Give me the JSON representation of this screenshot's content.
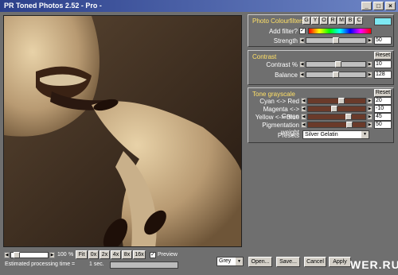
{
  "window": {
    "title": "PR Toned Photos 2.52 - Pro -",
    "min": "_",
    "max": "□",
    "close": "×"
  },
  "colourfilters": {
    "title": "Photo Colourfilters",
    "buttons": [
      "G",
      "Y",
      "O",
      "R",
      "M",
      "B",
      "C"
    ],
    "add_filter_label": "Add filter?",
    "add_filter_checked": "✓",
    "strength_label": "Strength",
    "strength_value": "50",
    "strength_level": 0.5
  },
  "contrast": {
    "title": "Contrast",
    "reset": "Reset",
    "contrast_label": "Contrast %",
    "contrast_value": "10",
    "contrast_level": 0.55,
    "balance_label": "Balance",
    "balance_value": "128",
    "balance_level": 0.5
  },
  "tone": {
    "title": "Tone grayscale",
    "reset": "Reset",
    "rows": [
      {
        "label": "Cyan <-> Red",
        "value": "20",
        "level": 0.6
      },
      {
        "label": "Magenta <-> Green",
        "value": "-10",
        "level": 0.45
      },
      {
        "label": "Yellow <-> Blue",
        "value": "45",
        "level": 0.73
      },
      {
        "label": "Pigmentation weight",
        "value": "50",
        "level": 0.75
      }
    ],
    "presets_label": "Presets",
    "presets_value": "Silver Gelatin"
  },
  "bottom": {
    "zoom_value": "100",
    "zoom_unit": "%",
    "zoom_buttons": [
      "Fit",
      "0x",
      "2x",
      "4x",
      "8x",
      "16x"
    ],
    "preview_label": "Preview",
    "preview_checked": "✓",
    "estimate": "Estimated processing time =",
    "estimate_value": "1 sec.",
    "mode_value": "Grey",
    "open": "Open...",
    "save": "Save...",
    "cancel": "Cancel",
    "apply": "Apply"
  },
  "watermark": "WER.RU",
  "colors": {
    "title_start": "#2b3f8a",
    "legend": "#ffe066",
    "bg": "#6f6f6f"
  }
}
